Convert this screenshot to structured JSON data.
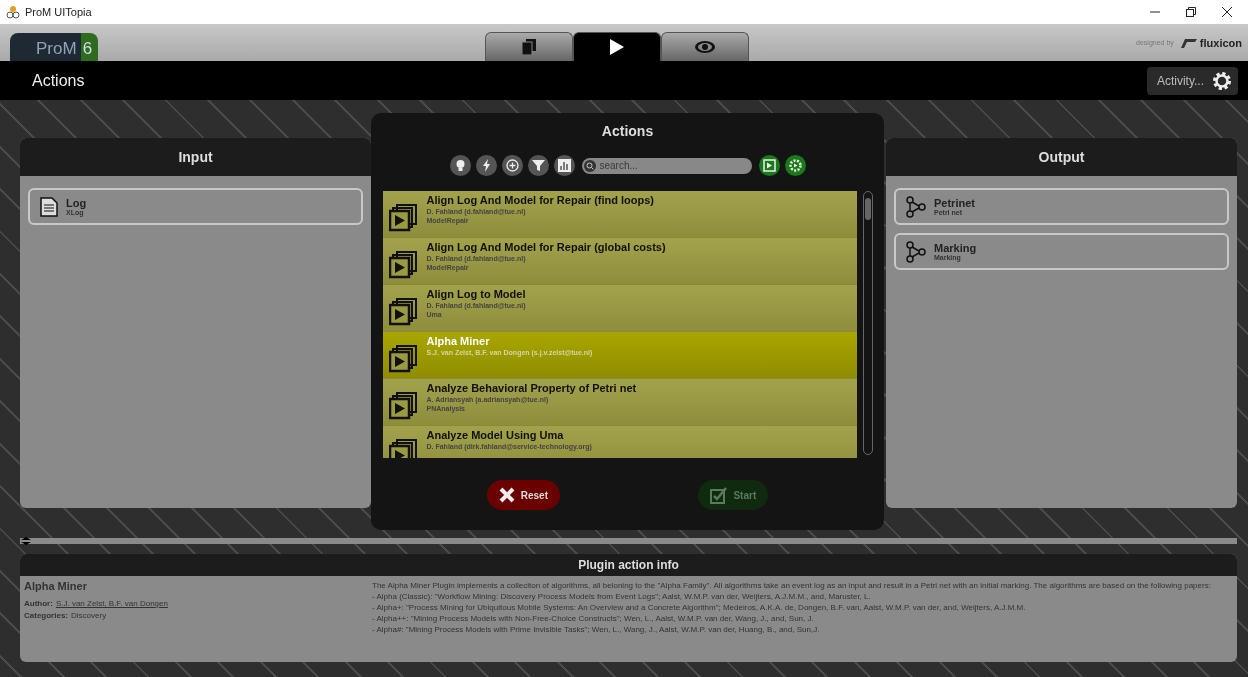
{
  "window": {
    "title": "ProM UITopia"
  },
  "header": {
    "logo_text": "ProM",
    "logo_version": "6",
    "tabs": [
      {
        "kind": "copy",
        "selected": false
      },
      {
        "kind": "play",
        "selected": true
      },
      {
        "kind": "eye",
        "selected": false
      }
    ],
    "credit": "designed by",
    "brand": "fluxicon"
  },
  "toolbar": {
    "title": "Actions",
    "activity_button": "Activity..."
  },
  "input": {
    "title": "Input",
    "items": [
      {
        "name": "Log",
        "type": "XLog",
        "kind": "document"
      }
    ]
  },
  "output": {
    "title": "Output",
    "items": [
      {
        "name": "Petrinet",
        "type": "Petri net",
        "kind": "net"
      },
      {
        "name": "Marking",
        "type": "Marking",
        "kind": "net"
      }
    ]
  },
  "dialog": {
    "title": "Actions",
    "search": {
      "placeholder": "search..."
    },
    "actions": [
      {
        "title": "Align Log And Model for Repair (find loops)",
        "author": "D. Fahland (d.fahland@tue.nl)",
        "category": "ModelRepair",
        "selected": false
      },
      {
        "title": "Align Log And Model for Repair (global costs)",
        "author": "D. Fahland (d.fahland@tue.nl)",
        "category": "ModelRepair",
        "selected": false
      },
      {
        "title": "Align Log to Model",
        "author": "D. Fahland (d.fahland@tue.nl)",
        "category": "Uma",
        "selected": false
      },
      {
        "title": "Alpha Miner",
        "author": "S.J. van Zelst, B.F. van Dongen (s.j.v.zelst@tue.nl)",
        "selected": true
      },
      {
        "title": "Analyze Behavioral Property of Petri net",
        "author": "A. Adriansyah (a.adriansyah@tue.nl)",
        "category": "PNAnalysis",
        "selected": false
      },
      {
        "title": "Analyze Model Using Uma",
        "author": "D. Fahland (dirk.fahland@service-technology.org)",
        "selected": false
      }
    ],
    "reset_button": "Reset",
    "start_button": {
      "label": "Start",
      "disabled": true
    }
  },
  "info": {
    "title": "Plugin action info",
    "plugin_name": "Alpha Miner",
    "author_label": "Author:",
    "author": "S.J. van Zelst, B.F. van Dongen",
    "categories_label": "Categories:",
    "categories": "Discovery",
    "description": [
      "The Alpha Miner Plugin implements a colleciton of algorithms, all beloning to the \"Alpha Family\". All algorithms take an event log as an input and result in a Petri net with an initial marking. The algorithms are based on the following papers:",
      "- Alpha (Classic): \"Workflow Mining: Discovery Process Models from Event Logs\"; Aalst, W.M.P. van der, Weijters, A.J.M.M., and, Maruster, L.",
      "- Alpha+: \"Process Mining for Ubiquitous Mobile Systems: An Overview and a Concrete Algorithm\"; Medeiros, A.K.A. de, Dongen, B.F. van, Aalst, W.M.P. van der, and, Weijters, A.J.M.M.",
      "- Alpha++: \"Mining Process Models with Non-Free-Choice Constructs\"; Wen, L., Aalst, W.M.P. van der, Wang, J., and, Sun, J.",
      "- Alpha#: \"Mining Process Models with Prime Invisible Tasks\"; Wen, L., Wang, J., Aalst, W.M.P. van der, Huang, B., and, Sun,J."
    ]
  }
}
